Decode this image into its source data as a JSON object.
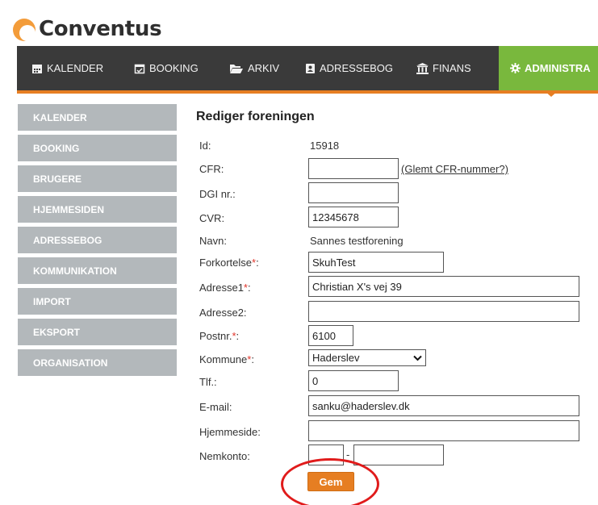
{
  "brand": {
    "name": "Conventus",
    "accent": "#e67e22",
    "nav_bg": "#3a3a3a",
    "active_bg": "#79b83d"
  },
  "nav": {
    "items": [
      {
        "label": "KALENDER",
        "icon": "calendar-icon"
      },
      {
        "label": "BOOKING",
        "icon": "calendar-check-icon"
      },
      {
        "label": "ARKIV",
        "icon": "folder-open-icon"
      },
      {
        "label": "ADRESSEBOG",
        "icon": "address-book-icon"
      },
      {
        "label": "FINANS",
        "icon": "bank-icon"
      },
      {
        "label": "ADMINISTRA",
        "icon": "gear-icon",
        "active": true
      }
    ]
  },
  "sidebar": {
    "items": [
      {
        "label": "KALENDER"
      },
      {
        "label": "BOOKING"
      },
      {
        "label": "BRUGERE"
      },
      {
        "label": "HJEMMESIDEN"
      },
      {
        "label": "ADRESSEBOG"
      },
      {
        "label": "KOMMUNIKATION"
      },
      {
        "label": "IMPORT"
      },
      {
        "label": "EKSPORT"
      },
      {
        "label": "ORGANISATION"
      }
    ]
  },
  "form": {
    "title": "Rediger foreningen",
    "id_label": "Id:",
    "id_value": "15918",
    "cfr_label": "CFR:",
    "cfr_value": "",
    "cfr_link": "(Glemt CFR-nummer?)",
    "dgi_label": "DGI nr.:",
    "dgi_value": "",
    "cvr_label": "CVR:",
    "cvr_value": "12345678",
    "navn_label": "Navn:",
    "navn_value": "Sannes testforening",
    "forkortelse_label": "Forkortelse",
    "forkortelse_value": "SkuhTest",
    "adresse1_label": "Adresse1",
    "adresse1_value": "Christian X's vej 39",
    "adresse2_label": "Adresse2:",
    "adresse2_value": "",
    "postnr_label": "Postnr.",
    "postnr_value": "6100",
    "kommune_label": "Kommune",
    "kommune_value": "Haderslev",
    "tlf_label": "Tlf.:",
    "tlf_value": "0",
    "email_label": "E-mail:",
    "email_value": "sanku@haderslev.dk",
    "hjemmeside_label": "Hjemmeside:",
    "hjemmeside_value": "",
    "nemkonto_label": "Nemkonto:",
    "nemkonto_reg": "",
    "nemkonto_separator": "-",
    "nemkonto_konto": "",
    "required_mark": "*",
    "label_suffix": ":",
    "save_label": "Gem"
  }
}
